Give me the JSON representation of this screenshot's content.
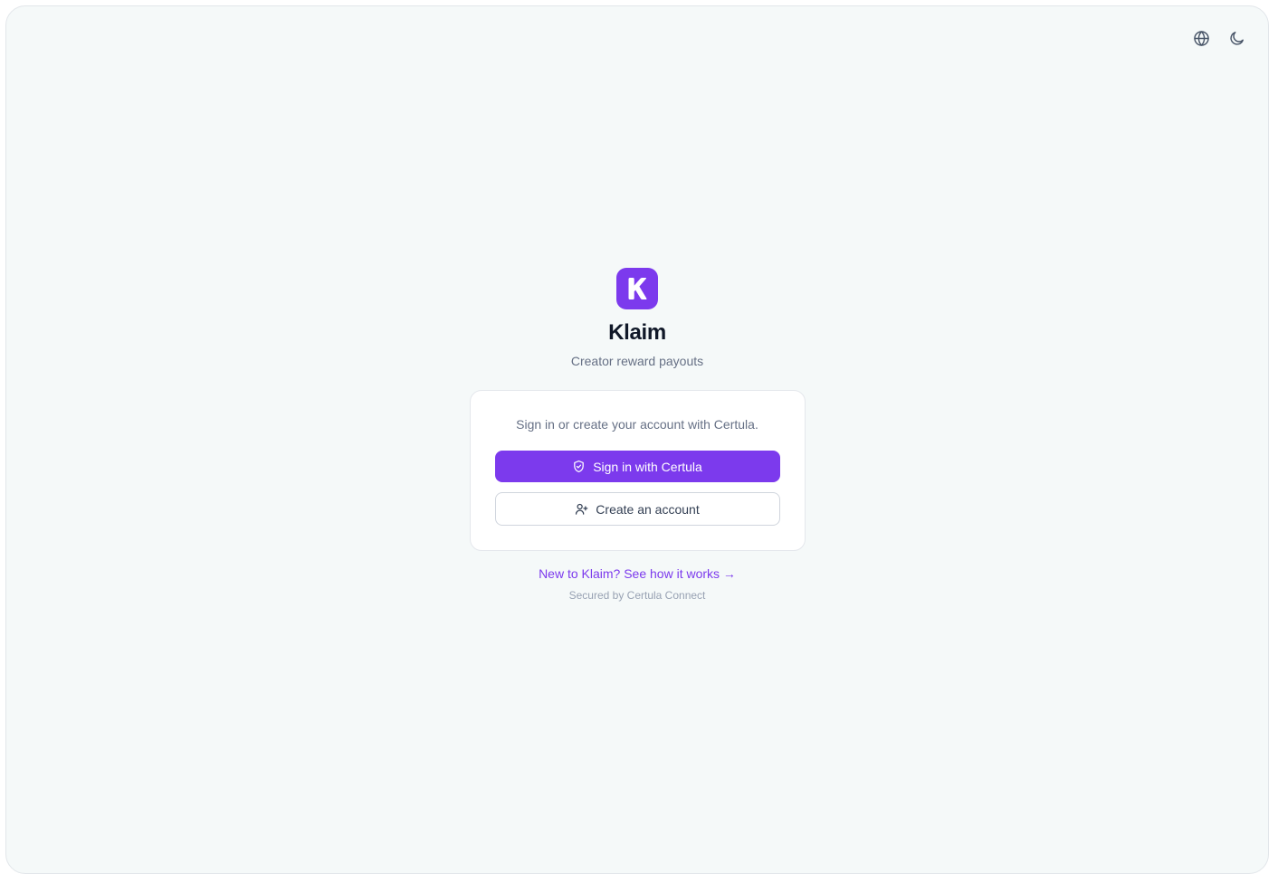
{
  "header": {
    "language_icon": "globe-icon",
    "theme_icon": "moon-icon"
  },
  "brand": {
    "logo_letter": "K",
    "name": "Klaim",
    "tagline": "Creator reward payouts",
    "accent_color": "#7c3aed"
  },
  "card": {
    "intro": "Sign in or create your account with Certula.",
    "sign_in_label": "Sign in with Certula",
    "sign_in_icon": "shield-check-icon",
    "create_label": "Create an account",
    "create_icon": "user-plus-icon"
  },
  "footer": {
    "how_it_works_link": "New to Klaim? See how it works →",
    "secured_text": "Secured by Certula Connect"
  }
}
